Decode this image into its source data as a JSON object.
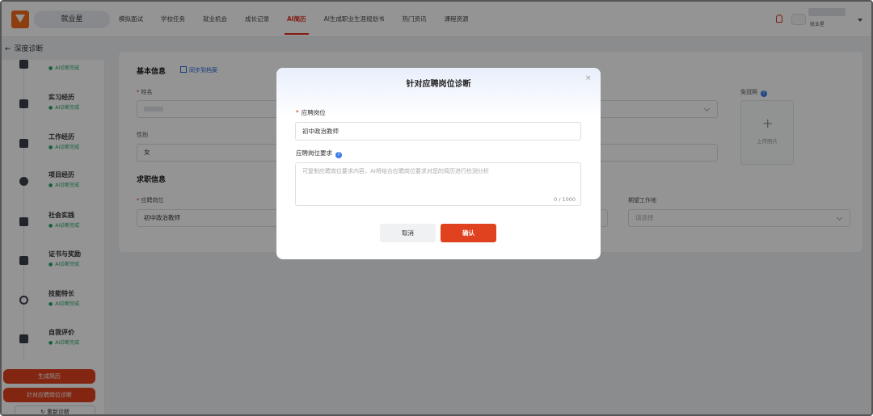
{
  "nav": {
    "brand": "就业星",
    "items": [
      "模拟面试",
      "学校任务",
      "就业机会",
      "成长记录",
      "AI简历",
      "AI生成职业生涯规划书",
      "热门资讯",
      "课程资源"
    ],
    "active_index": 4,
    "user_name": "就业星"
  },
  "breadcrumb": "深度诊断",
  "sidebar": {
    "items": [
      {
        "title": "",
        "status": "AI诊断完成"
      },
      {
        "title": "实习经历",
        "status": "AI诊断完成"
      },
      {
        "title": "工作经历",
        "status": "AI诊断完成"
      },
      {
        "title": "项目经历",
        "status": "AI诊断完成"
      },
      {
        "title": "社会实践",
        "status": "AI诊断完成"
      },
      {
        "title": "证书与奖励",
        "status": "AI诊断完成"
      },
      {
        "title": "技能特长",
        "status": "AI诊断完成"
      },
      {
        "title": "自我评价",
        "status": "AI诊断完成"
      }
    ],
    "generate_button": "生成简历",
    "diagnose_button": "针对应聘岗位诊断",
    "rediagnose_button": "重新诊断"
  },
  "form": {
    "basic_title": "基本信息",
    "sync_label": "同步到档案",
    "name_label": "姓名",
    "gender_label": "性别",
    "gender_value": "女",
    "photo_label": "免冠照",
    "photo_upload": "上传照片",
    "job_title": "求职信息",
    "position_label": "应聘岗位",
    "position_value": "初中政治教师",
    "location_label": "期望工作地",
    "location_placeholder": "请选择"
  },
  "modal": {
    "title": "针对应聘岗位诊断",
    "position_label": "应聘岗位",
    "position_value": "初中政治教师",
    "requirement_label": "应聘岗位要求",
    "requirement_placeholder": "可复制应聘岗位要求内容，AI将结合应聘岗位要求对您的简历进行检测分析",
    "counter": "0 / 1000",
    "cancel": "取消",
    "confirm": "确认",
    "close": "×"
  },
  "colors": {
    "accent": "#e0421f",
    "success": "#21a366",
    "link": "#2b64d8"
  }
}
